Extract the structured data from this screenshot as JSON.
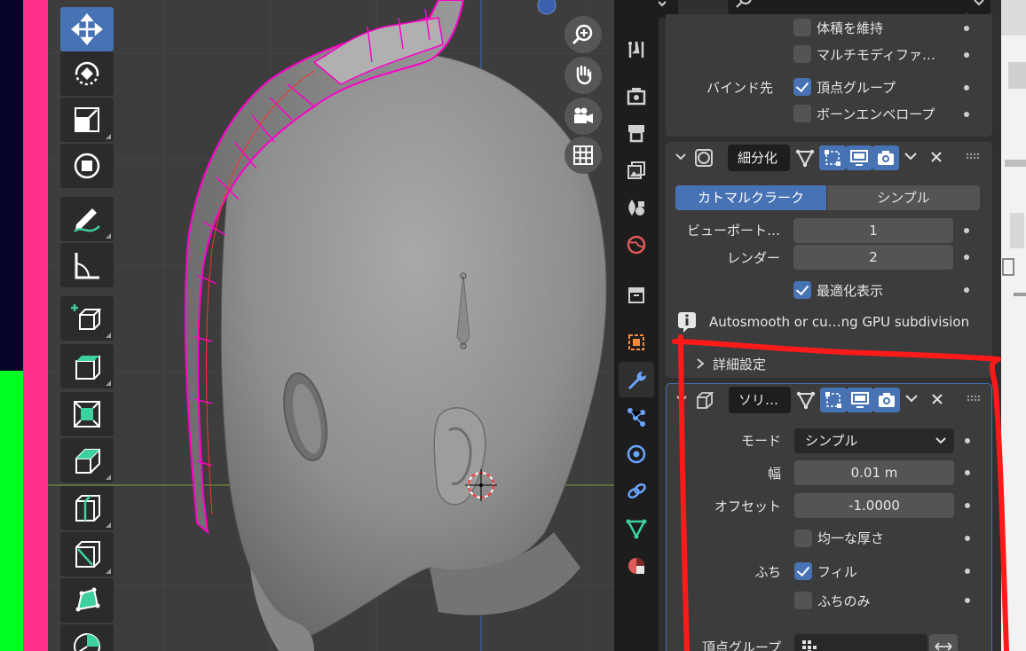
{
  "modifiers_top": {
    "volume_preserve_label": "体積を維持",
    "multi_modifier_label": "マルチモディファ…",
    "bind_to_label": "バインド先",
    "vertex_group_label": "頂点グループ",
    "bone_envelope_label": "ボーンエンベロープ"
  },
  "subdivision": {
    "name": "細分化",
    "method_catmull": "カトマルクラーク",
    "method_simple": "シンプル",
    "viewport_label": "ビューポート…",
    "viewport_value": "1",
    "render_label": "レンダー",
    "render_value": "2",
    "optimal_display_label": "最適化表示",
    "info_text": "Autosmooth or cu…ng GPU subdivision",
    "advanced_label": "詳細設定"
  },
  "solidify": {
    "name": "ソリ…",
    "mode_label": "モード",
    "mode_value": "シンプル",
    "thickness_label": "幅",
    "thickness_value": "0.01 m",
    "offset_label": "オフセット",
    "offset_value": "-1.0000",
    "even_thickness_label": "均一な厚さ",
    "rim_label": "ふち",
    "fill_label": "フィル",
    "rim_only_label": "ふちのみ",
    "vertex_group_label": "頂点グループ"
  },
  "colors": {
    "accent": "#4772b3",
    "annotation": "#ff1a1a",
    "panel_bg": "#3c3c3c"
  }
}
